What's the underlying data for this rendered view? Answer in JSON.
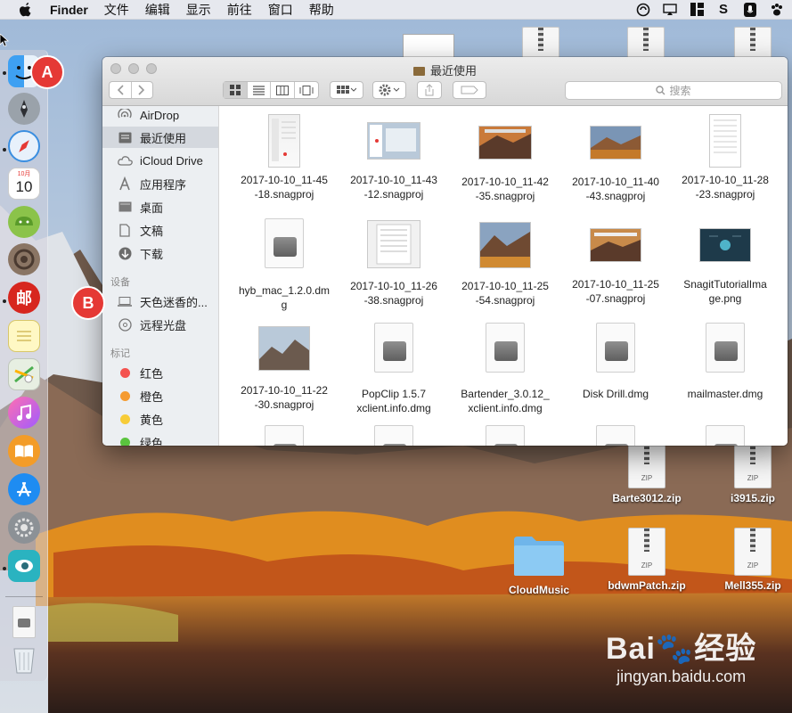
{
  "menubar": {
    "app_name": "Finder",
    "menus": [
      "文件",
      "编辑",
      "显示",
      "前往",
      "窗口",
      "帮助"
    ]
  },
  "dock": {
    "apps": [
      "finder-icon",
      "launchpad-icon",
      "safari-icon",
      "calendar-icon",
      "android-icon",
      "rocket-ring-icon",
      "mail-app-icon",
      "notes-icon",
      "maps-icon",
      "itunes-icon",
      "ibooks-icon",
      "app-store-icon",
      "system-preferences-icon",
      "eye-app-icon",
      "dmg-doc-icon",
      "trash-icon"
    ],
    "calendar_month": "10月",
    "calendar_day": "10",
    "mail_glyph": "邮"
  },
  "desktop": {
    "items": [
      {
        "label": "Barte3012.zip",
        "type": "zip"
      },
      {
        "label": "i3915.zip",
        "type": "zip"
      },
      {
        "label": "CloudMusic",
        "type": "folder"
      },
      {
        "label": "bdwmPatch.zip",
        "type": "zip"
      },
      {
        "label": "Mell355.zip",
        "type": "zip"
      }
    ],
    "zip_tag": "ZIP"
  },
  "finder": {
    "title": "最近使用",
    "search_placeholder": "搜索",
    "sidebar": {
      "favorites": [
        "AirDrop",
        "最近使用",
        "iCloud Drive",
        "应用程序",
        "桌面",
        "文稿",
        "下载"
      ],
      "devices_header": "设备",
      "devices": [
        "天色迷香的...",
        "远程光盘"
      ],
      "tags_header": "标记",
      "tags": [
        {
          "name": "红色",
          "color": "#f4524f"
        },
        {
          "name": "橙色",
          "color": "#f59b31"
        },
        {
          "name": "黄色",
          "color": "#f7cc38"
        },
        {
          "name": "绿色",
          "color": "#5ac43e"
        }
      ]
    },
    "files": [
      {
        "name1": "2017-10-10_11-45",
        "name2": "-18.snagproj"
      },
      {
        "name1": "2017-10-10_11-43",
        "name2": "-12.snagproj"
      },
      {
        "name1": "2017-10-10_11-42",
        "name2": "-35.snagproj"
      },
      {
        "name1": "2017-10-10_11-40",
        "name2": "-43.snagproj"
      },
      {
        "name1": "2017-10-10_11-28",
        "name2": "-23.snagproj"
      },
      {
        "name1": "hyb_mac_1.2.0.dm",
        "name2": "g"
      },
      {
        "name1": "2017-10-10_11-26",
        "name2": "-38.snagproj"
      },
      {
        "name1": "2017-10-10_11-25",
        "name2": "-54.snagproj"
      },
      {
        "name1": "2017-10-10_11-25",
        "name2": "-07.snagproj"
      },
      {
        "name1": "SnagitTutorialIma",
        "name2": "ge.png"
      },
      {
        "name1": "2017-10-10_11-22",
        "name2": "-30.snagproj"
      },
      {
        "name1": "PopClip 1.5.7",
        "name2": "xclient.info.dmg"
      },
      {
        "name1": "Bartender_3.0.12_",
        "name2": "xclient.info.dmg"
      },
      {
        "name1": "Disk Drill.dmg",
        "name2": ""
      },
      {
        "name1": "mailmaster.dmg",
        "name2": ""
      }
    ]
  },
  "badges": {
    "a": "A",
    "b": "B"
  },
  "watermark": {
    "brand": "Bai🐾经验",
    "url": "jingyan.baidu.com"
  }
}
